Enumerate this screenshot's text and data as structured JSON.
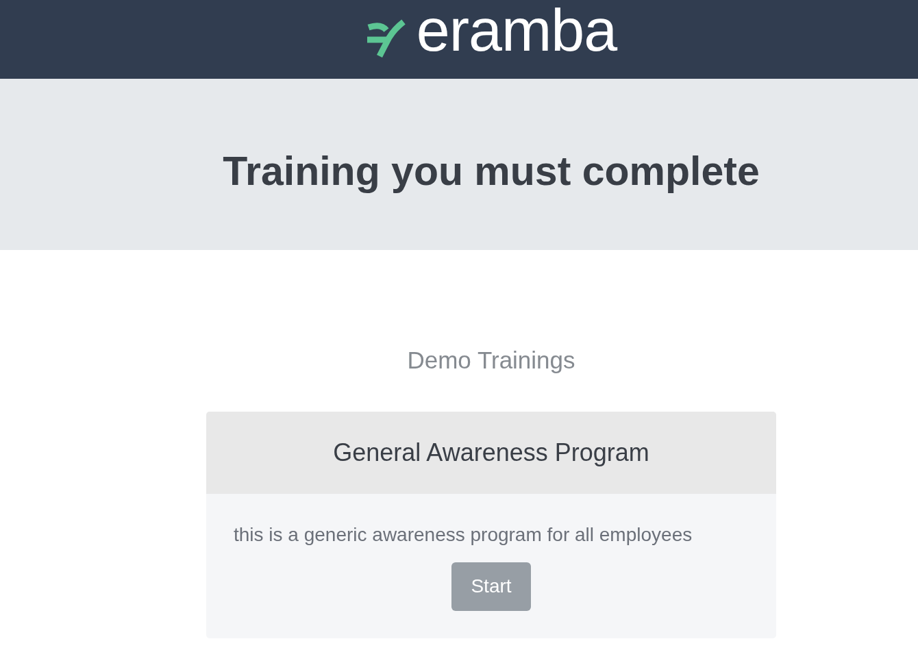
{
  "header": {
    "logo": {
      "wordmark": "eramba"
    }
  },
  "hero": {
    "title": "Training you must complete"
  },
  "section": {
    "title": "Demo Trainings"
  },
  "trainings": [
    {
      "title": "General Awareness Program",
      "description": "this is a generic awareness program for all employees",
      "button": "Start"
    }
  ]
}
